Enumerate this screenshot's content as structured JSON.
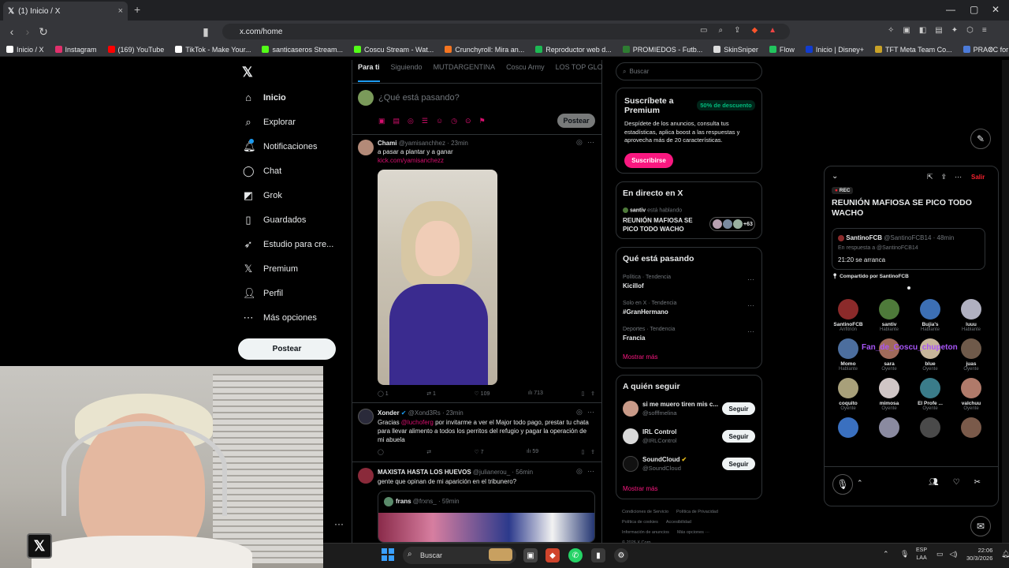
{
  "browser": {
    "tab_title": "(1) Inicio / X",
    "tab_close": "×",
    "new_tab": "+",
    "url": "x.com/home",
    "bookmarks": [
      {
        "label": "Inicio / X",
        "color": "#ffffff"
      },
      {
        "label": "Instagram",
        "color": "#e1306c"
      },
      {
        "label": "(169) YouTube",
        "color": "#ff0000"
      },
      {
        "label": "TikTok - Make Your...",
        "color": "#ffffff"
      },
      {
        "label": "santicaseros Stream...",
        "color": "#53fc18"
      },
      {
        "label": "Coscu Stream - Wat...",
        "color": "#53fc18"
      },
      {
        "label": "Crunchyroll: Mira an...",
        "color": "#f47521"
      },
      {
        "label": "Reproductor web d...",
        "color": "#1db954"
      },
      {
        "label": "PROMIEDOS - Futb...",
        "color": "#2e7d32"
      },
      {
        "label": "SkinSniper",
        "color": "#dddddd"
      },
      {
        "label": "Flow",
        "color": "#22c55e"
      },
      {
        "label": "Inicio | Disney+",
        "color": "#113ccf"
      },
      {
        "label": "TFT Meta Team Co...",
        "color": "#c9a227"
      },
      {
        "label": "PRACC for Counter-...",
        "color": "#4c7bd9"
      }
    ],
    "window_controls": [
      "—",
      "▢",
      "✕"
    ]
  },
  "nav": {
    "logo": "𝕏",
    "items": [
      {
        "label": "Inicio",
        "icon": "home-icon",
        "glyph": "⌂",
        "active": true
      },
      {
        "label": "Explorar",
        "icon": "search-icon",
        "glyph": "⌕"
      },
      {
        "label": "Notificaciones",
        "icon": "bell-icon",
        "glyph": "🔔︎"
      },
      {
        "label": "Chat",
        "icon": "chat-icon",
        "glyph": "◯"
      },
      {
        "label": "Grok",
        "icon": "grok-icon",
        "glyph": "◩"
      },
      {
        "label": "Guardados",
        "icon": "bookmark-icon",
        "glyph": "▯"
      },
      {
        "label": "Estudio para cre...",
        "icon": "rocket-icon",
        "glyph": "➶"
      },
      {
        "label": "Premium",
        "icon": "x-icon",
        "glyph": "𝕏"
      },
      {
        "label": "Perfil",
        "icon": "person-icon",
        "glyph": "👤︎"
      },
      {
        "label": "Más opciones",
        "icon": "more-icon",
        "glyph": "⋯"
      }
    ],
    "post_button": "Postear",
    "more": "···"
  },
  "feed": {
    "tabs": [
      "Para ti",
      "Siguiendo",
      "MUTDARGENTINA",
      "Coscu Army",
      "LOS TOP GLOBAL"
    ],
    "composer_placeholder": "¿Qué está pasando?",
    "composer_post": "Postear",
    "tweets": [
      {
        "name": "Chami",
        "handle": "@yamisanchhez",
        "time": "· 23min",
        "text": "a pasar a plantar y a ganar",
        "link": "kick.com/yamisanchezz",
        "replies": "1",
        "reposts": "1",
        "likes": "109",
        "views": "713"
      },
      {
        "name": "Xonder",
        "handle": "@Xond3Rs",
        "time": "· 23min",
        "text_pre": "Gracias",
        "mention": "@luchoferg",
        "text_post": "por invitarme a ver el Major todo pago, prestar tu chata para llevar alimento a todos los perritos del refugio y pagar la operación de mi abuela",
        "likes": "7",
        "views": "59"
      },
      {
        "name": "MAXISTA HASTA LOS HUEVOS",
        "handle": "@julianerou_",
        "time": "· 56min",
        "text": "gente que opinan de mi aparición en el tribunero?",
        "quoted_name": "frans",
        "quoted_handle": "@frxns_",
        "quoted_time": "· 59min"
      }
    ]
  },
  "sidebar": {
    "search_placeholder": "Buscar",
    "premium": {
      "title": "Suscríbete a Premium",
      "badge": "50% de descuento",
      "text": "Despídete de los anuncios, consulta tus estadísticas, aplica boost a las respuestas y aprovecha más de 20 características.",
      "button": "Suscribirse"
    },
    "live": {
      "title": "En directo en X",
      "host": "santiv",
      "status": "está hablando",
      "space_title": "REUNIÓN MAFIOSA SE PICO TODO WACHO",
      "count": "+63"
    },
    "trending": {
      "title": "Qué está pasando",
      "items": [
        {
          "context": "Política · Tendencia",
          "topic": "Kicillof"
        },
        {
          "context": "Solo en X · Tendencia",
          "topic": "#GranHermano"
        },
        {
          "context": "Deportes · Tendencia",
          "topic": "Francia"
        }
      ],
      "more": "Mostrar más"
    },
    "who_to_follow": {
      "title": "A quién seguir",
      "items": [
        {
          "name": "si me muero tiren mis c...",
          "handle": "@sofffmelina",
          "button": "Seguir"
        },
        {
          "name": "IRL Control",
          "handle": "@IRLControl",
          "button": "Seguir"
        },
        {
          "name": "SoundCloud",
          "handle": "@SoundCloud",
          "button": "Seguir"
        }
      ],
      "more": "Mostrar más"
    },
    "footer": [
      "Condiciones de Servicio",
      "Política de Privacidad",
      "Política de cookies",
      "Accesibilidad",
      "Información de anuncios",
      "Más opciones ···",
      "© 2026 X Corp."
    ]
  },
  "space": {
    "leave": "Salir",
    "rec": "REC",
    "title": "REUNIÓN MAFIOSA SE PICO TODO WACHO",
    "pinned": {
      "name": "SantinoFCB",
      "handle": "@SantinoFCB14",
      "time": "· 48min",
      "reply_to": "En respuesta a @SantinoFCB14",
      "text": "21:20 se arranca"
    },
    "shared_by": "Compartido por SantinoFCB",
    "overlay_name": "Fan_de_Coscu_chupeton",
    "participants": [
      {
        "name": "SantinoFCB",
        "role": "Anfitrión",
        "color": "#8b2a2a"
      },
      {
        "name": "santiv",
        "role": "Hablante",
        "color": "#4e7a3a"
      },
      {
        "name": "Bujia's",
        "role": "Hablante",
        "color": "#3c6fb4"
      },
      {
        "name": "luuu",
        "role": "Hablante",
        "color": "#b0b0c0"
      },
      {
        "name": "Momo",
        "role": "Hablante",
        "color": "#4c6e9e"
      },
      {
        "name": "sara",
        "role": "Oyente",
        "color": "#a06a5a"
      },
      {
        "name": "blue",
        "role": "Oyente",
        "color": "#c7b59a"
      },
      {
        "name": "juas",
        "role": "Oyente",
        "color": "#6f5a4a"
      },
      {
        "name": "coquito",
        "role": "Oyente",
        "color": "#a8a07a"
      },
      {
        "name": "mimosa",
        "role": "Oyente",
        "color": "#d0c6c6"
      },
      {
        "name": "El Profe ...",
        "role": "Oyente",
        "color": "#3a7c8a"
      },
      {
        "name": "valchuu",
        "role": "Oyente",
        "color": "#b07a6a"
      },
      {
        "name": "",
        "role": "",
        "color": "#3a70c0"
      },
      {
        "name": "",
        "role": "",
        "color": "#8a8aa0"
      },
      {
        "name": "",
        "role": "",
        "color": "#4a4a4a"
      },
      {
        "name": "",
        "role": "",
        "color": "#7a5a4a"
      }
    ]
  },
  "taskbar": {
    "search": "Buscar",
    "lang": "ESP",
    "region": "LAA",
    "time": "22:06",
    "date": "30/3/2026"
  }
}
